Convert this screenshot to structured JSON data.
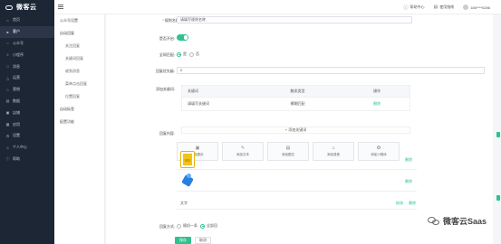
{
  "app": {
    "brand": "微客云"
  },
  "topbar": {
    "help": "帮助中心",
    "guide": "使用指南",
    "account": "186****5286"
  },
  "sidebar": {
    "items": [
      {
        "label": "首页",
        "icon": "home-icon"
      },
      {
        "label": "客户",
        "icon": "customer-icon"
      },
      {
        "label": "公众号",
        "icon": "official-account-icon"
      },
      {
        "label": "小程序",
        "icon": "miniapp-icon"
      },
      {
        "label": "消息",
        "icon": "message-icon"
      },
      {
        "label": "运营",
        "icon": "operation-icon"
      },
      {
        "label": "营销",
        "icon": "marketing-icon"
      },
      {
        "label": "数据",
        "icon": "data-icon"
      },
      {
        "label": "店铺",
        "icon": "shop-icon"
      },
      {
        "label": "应用",
        "icon": "app-icon"
      },
      {
        "label": "设置",
        "icon": "settings-icon"
      },
      {
        "label": "个人中心",
        "icon": "user-icon"
      },
      {
        "label": "帮助",
        "icon": "help-icon"
      }
    ],
    "active_index": 1
  },
  "subnav": {
    "items": [
      {
        "label": "公众号设置",
        "type": "item"
      },
      {
        "label": "自动回复",
        "type": "group"
      },
      {
        "label": "关注回复",
        "type": "child"
      },
      {
        "label": "关键词回复",
        "type": "child"
      },
      {
        "label": "收到消息",
        "type": "child"
      },
      {
        "label": "菜单点击回复",
        "type": "child"
      },
      {
        "label": "位置回复",
        "type": "child"
      },
      {
        "label": "自动标签",
        "type": "group"
      },
      {
        "label": "配置功能",
        "type": "item"
      }
    ]
  },
  "form": {
    "rule_name_label": "规则名称:",
    "rule_name_value": "请填写规则名称",
    "enable_label": "是否开启:",
    "all_match_label": "全网匹配:",
    "all_match_yes": "是",
    "all_match_no": "否",
    "priority_label": "回复优先级:",
    "priority_value": "0",
    "keywords_label": "添加关键词:",
    "kw_headers": [
      "关键词",
      "触发类型",
      "操作"
    ],
    "kw_rows": [
      {
        "keyword": "请填写关键词",
        "match": "模糊匹配",
        "action": "删除"
      }
    ],
    "add_kw": "+ 添加关键词",
    "content_label": "回复内容:",
    "content_types": [
      {
        "label": "添加图片",
        "icon": "image-icon"
      },
      {
        "label": "添加文本",
        "icon": "text-icon"
      },
      {
        "label": "添加图文",
        "icon": "news-icon"
      },
      {
        "label": "添加语音",
        "icon": "voice-icon"
      },
      {
        "label": "添加小程序",
        "icon": "miniprogram-icon"
      }
    ],
    "replies": [
      {
        "kind": "image",
        "del": "删除"
      },
      {
        "kind": "image",
        "del": "删除"
      },
      {
        "kind": "text",
        "text": "文字",
        "edit": "修改",
        "del": "删除"
      }
    ],
    "mode_label": "回复方式:",
    "mode_random": "随机一条",
    "mode_all": "全部回",
    "save": "保存",
    "cancel": "取消"
  },
  "watermark": "微客云Saas",
  "colors": {
    "accent": "#2ec28e",
    "sidebar_bg": "#1d2635"
  }
}
